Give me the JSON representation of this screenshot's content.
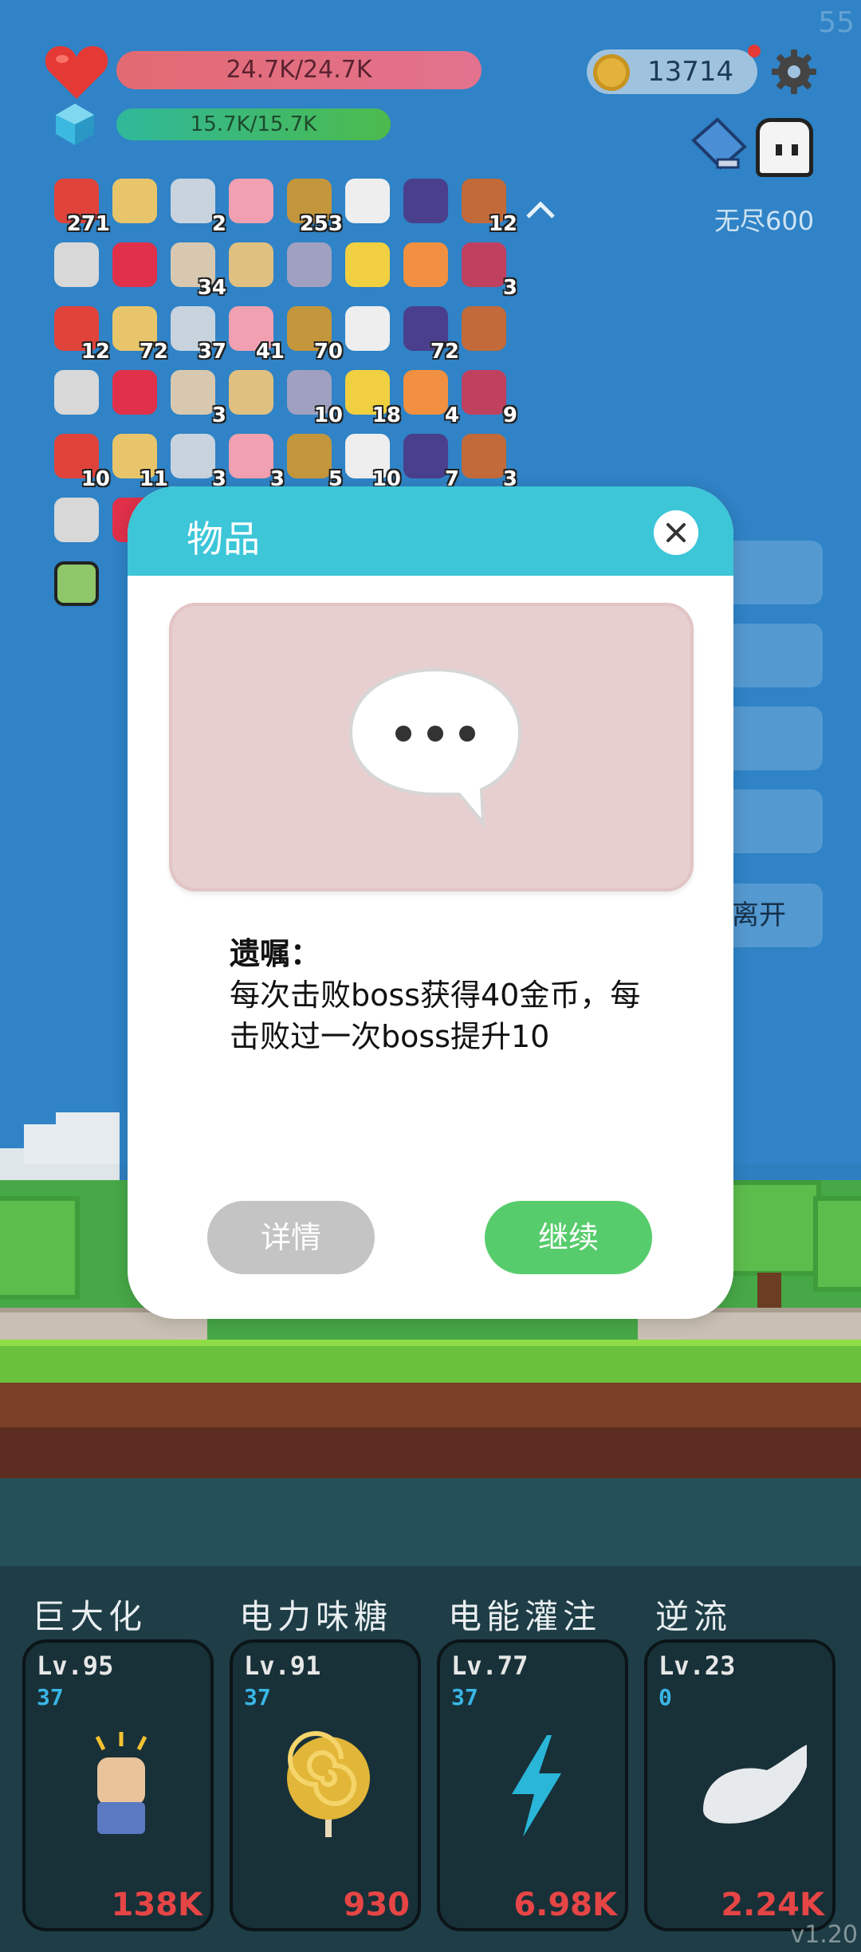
{
  "hud": {
    "fps": "55",
    "hp_text": "24.7K/24.7K",
    "mp_text": "15.7K/15.7K",
    "coins": "13714",
    "mode_label": "无尽600"
  },
  "items": [
    {
      "icon": "apple-icon",
      "count": "271"
    },
    {
      "icon": "map-icon",
      "count": ""
    },
    {
      "icon": "briefcase-icon",
      "count": "2"
    },
    {
      "icon": "ice-cream-icon",
      "count": ""
    },
    {
      "icon": "book-icon",
      "count": "253"
    },
    {
      "icon": "speech-bubble-icon",
      "count": ""
    },
    {
      "icon": "wizard-hat-icon",
      "count": ""
    },
    {
      "icon": "target-disc-icon",
      "count": "12"
    },
    {
      "icon": "dots-icon",
      "count": ""
    },
    {
      "icon": "ruby-icon",
      "count": ""
    },
    {
      "icon": "potion-icon",
      "count": "34"
    },
    {
      "icon": "scroll-icon",
      "count": ""
    },
    {
      "icon": "rocks-icon",
      "count": ""
    },
    {
      "icon": "magic-wand-icon",
      "count": ""
    },
    {
      "icon": "crown-icon",
      "count": ""
    },
    {
      "icon": "jam-jar-icon",
      "count": "3"
    },
    {
      "icon": "beer-icon",
      "count": "12"
    },
    {
      "icon": "tombstone-icon",
      "count": "72"
    },
    {
      "icon": "pineapple-icon",
      "count": "37"
    },
    {
      "icon": "meteor-icon",
      "count": "41"
    },
    {
      "icon": "bow-icon",
      "count": "70"
    },
    {
      "icon": "card-icon",
      "count": ""
    },
    {
      "icon": "pineapple-small-icon",
      "count": "72"
    },
    {
      "icon": "compass-icon",
      "count": ""
    },
    {
      "icon": "spiral-icon",
      "count": ""
    },
    {
      "icon": "playing-cards-icon",
      "count": ""
    },
    {
      "icon": "scroll-paper-icon",
      "count": "3"
    },
    {
      "icon": "heat-waves-icon",
      "count": ""
    },
    {
      "icon": "knife-icon",
      "count": "10"
    },
    {
      "icon": "shirt-icon",
      "count": "18"
    },
    {
      "icon": "strawberry-icon",
      "count": "4"
    },
    {
      "icon": "sword-icon",
      "count": "9"
    },
    {
      "icon": "watermelon-icon",
      "count": "10"
    },
    {
      "icon": "chat-icon",
      "count": "11"
    },
    {
      "icon": "envelope-icon",
      "count": "3"
    },
    {
      "icon": "pill-blue-icon",
      "count": "3"
    },
    {
      "icon": "pill-red-icon",
      "count": "5"
    },
    {
      "icon": "thermometer-icon",
      "count": "10"
    },
    {
      "icon": "flower-icon",
      "count": "7"
    },
    {
      "icon": "sunflower-icon",
      "count": "3"
    },
    {
      "icon": "ghost-icon",
      "count": ""
    },
    {
      "icon": "leaf-icon",
      "count": ""
    },
    {
      "icon": "lightbulb-icon",
      "count": ""
    }
  ],
  "side": {
    "leave_label": "离开"
  },
  "modal": {
    "title": "物品",
    "item_name": "遗嘱：",
    "description": "每次击败boss获得40金币，每击败过一次boss提升10",
    "detail_button": "详情",
    "continue_button": "继续"
  },
  "skills": [
    {
      "name": "巨大化",
      "level": "Lv.95",
      "sub": "37",
      "cost": "138K",
      "icon": "fist-icon"
    },
    {
      "name": "电力味糖",
      "level": "Lv.91",
      "sub": "37",
      "cost": "930",
      "icon": "lollipop-icon"
    },
    {
      "name": "电能灌注",
      "level": "Lv.77",
      "sub": "37",
      "cost": "6.98K",
      "icon": "lightning-icon"
    },
    {
      "name": "逆流",
      "level": "Lv.23",
      "sub": "0",
      "cost": "2.24K",
      "icon": "wing-icon"
    }
  ],
  "version": "v1.20",
  "colors": {
    "sky": "#2f83c6",
    "modal_header": "#3cc6d8",
    "continue": "#57cc6c",
    "detail": "#c4c4c4",
    "cost_red": "#e64545",
    "sub_blue": "#39b6e6"
  }
}
